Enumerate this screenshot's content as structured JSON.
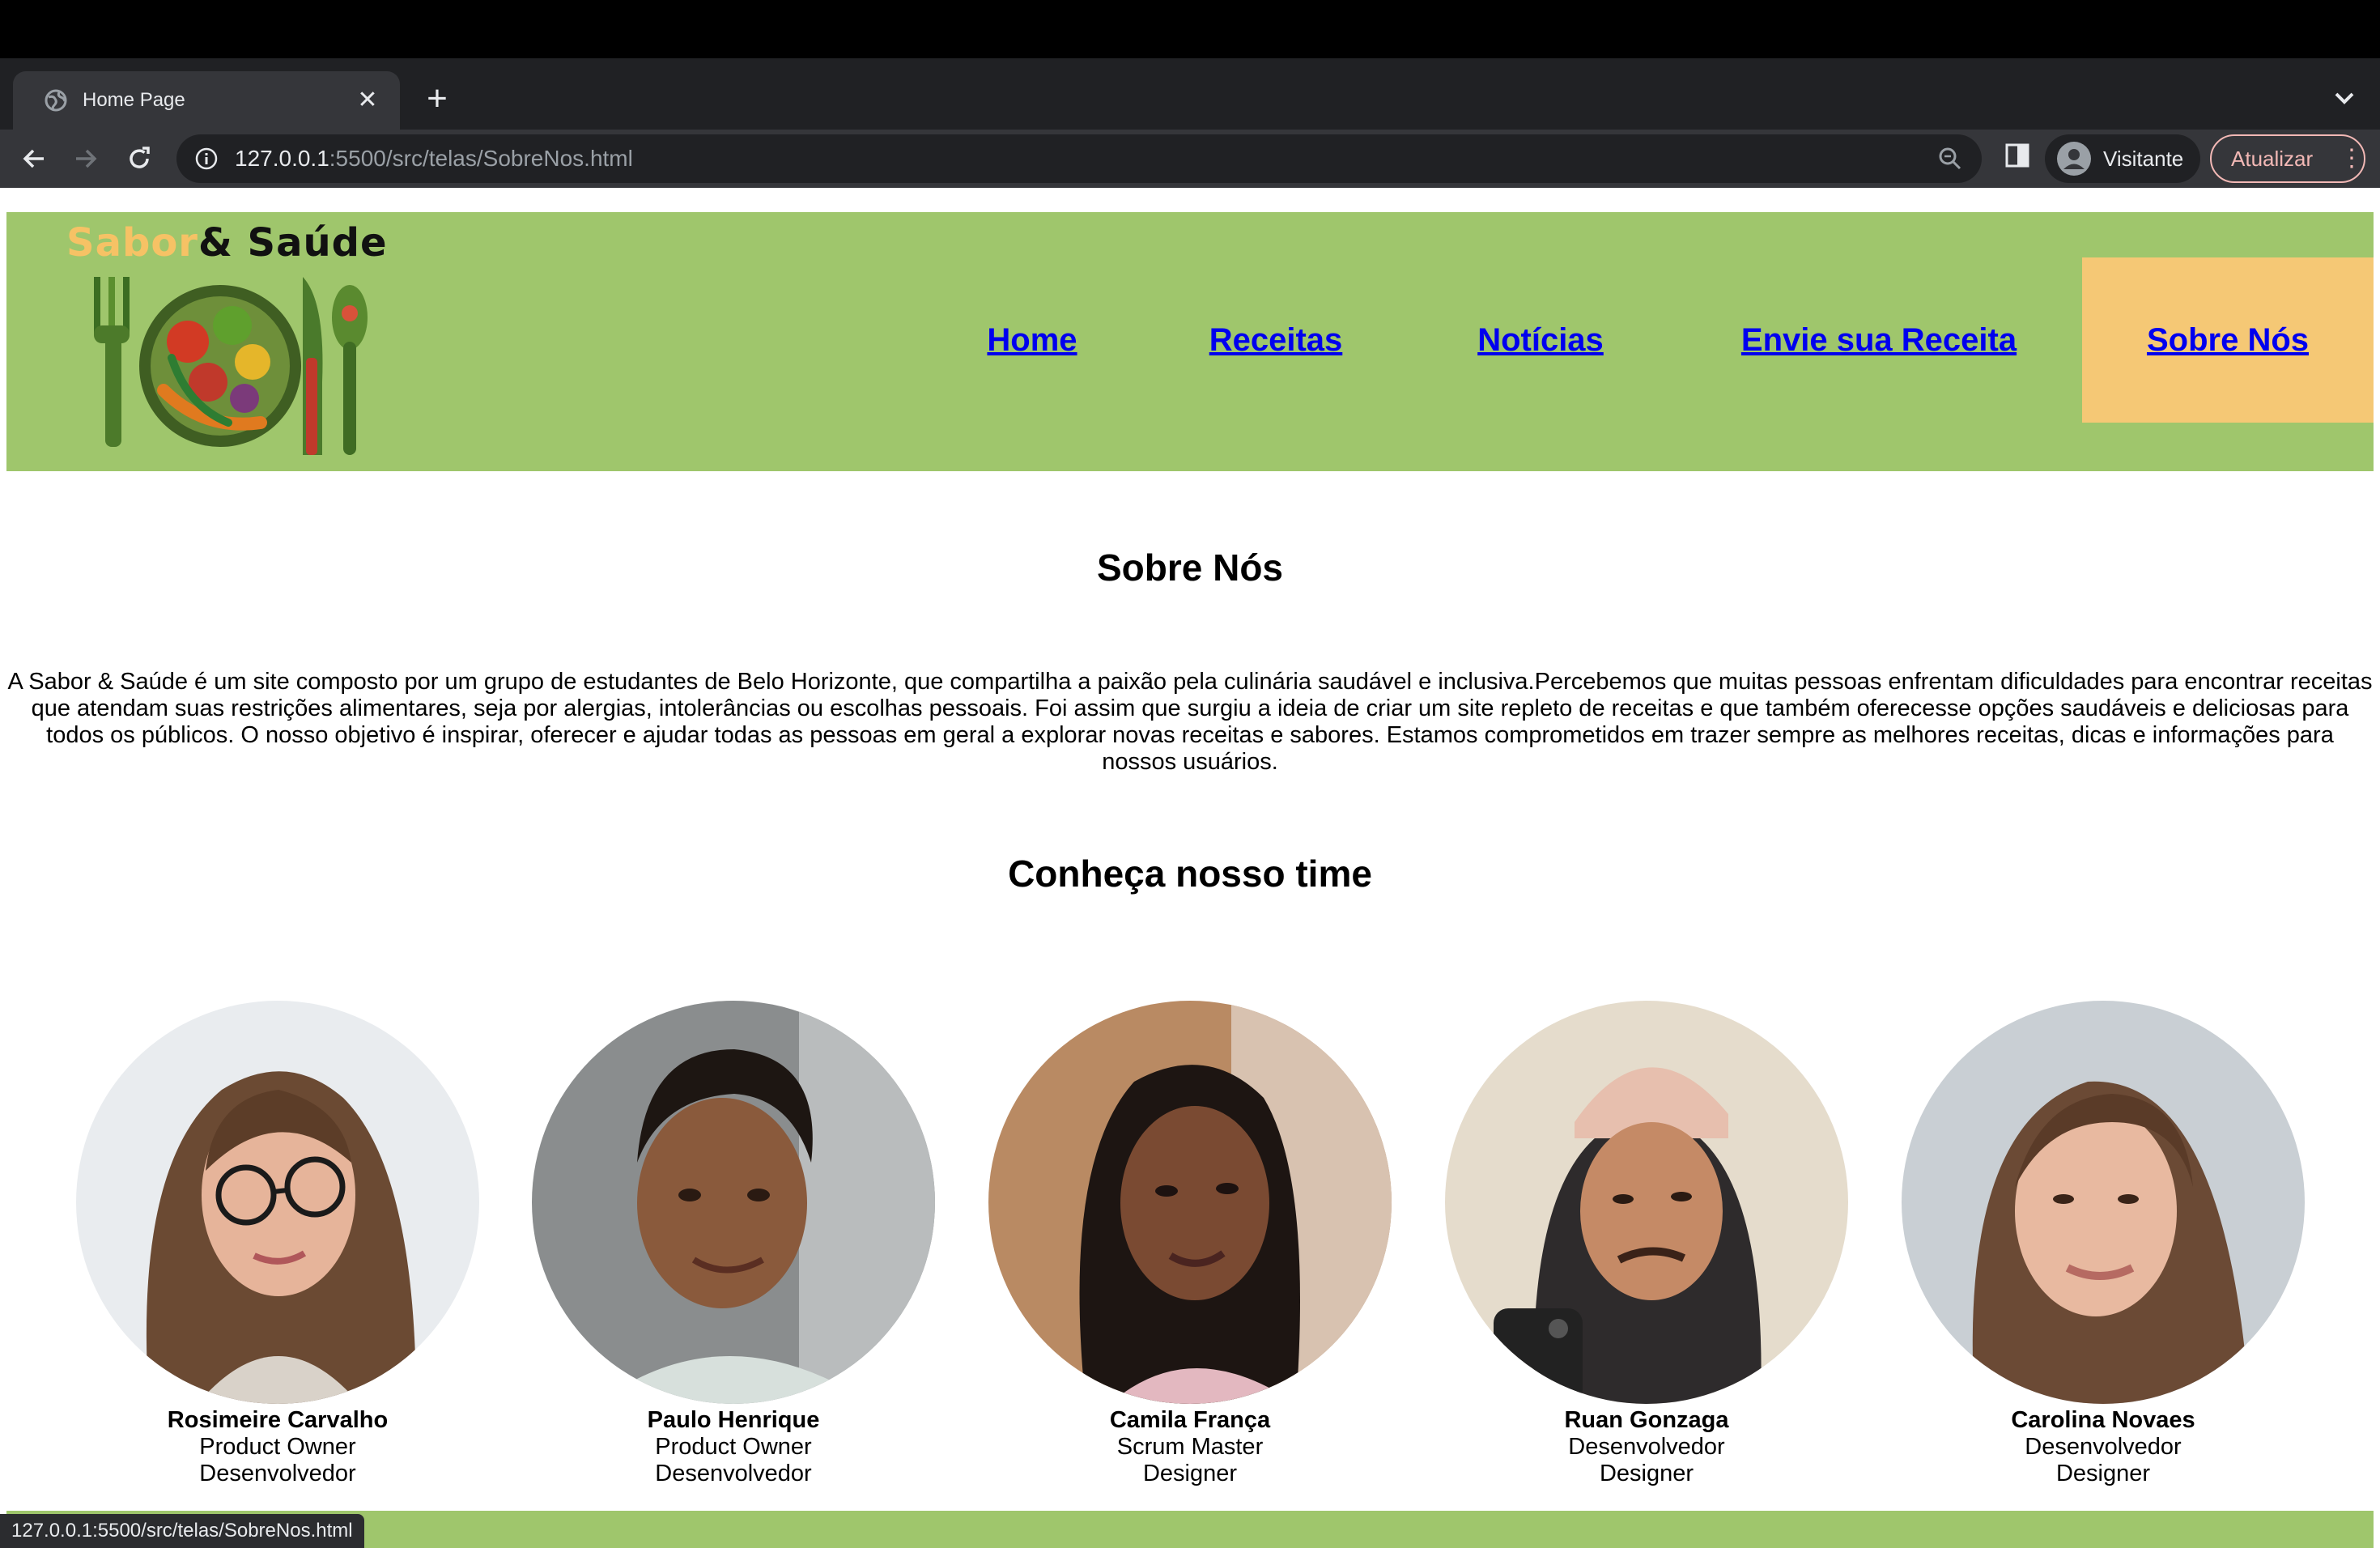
{
  "browser": {
    "tab_title": "Home Page",
    "url_host": "127.0.0.1",
    "url_rest": ":5500/src/telas/SobreNos.html",
    "profile_name": "Visitante",
    "update_label": "Atualizar",
    "status_url": "127.0.0.1:5500/src/telas/SobreNos.html"
  },
  "site": {
    "logo_word1": "Sabor",
    "logo_word2": "& Saúde",
    "nav": [
      {
        "label": "Home"
      },
      {
        "label": "Receitas"
      },
      {
        "label": "Notícias"
      },
      {
        "label": "Envie sua Receita"
      },
      {
        "label": "Sobre Nós"
      }
    ],
    "active_nav": "Sobre Nós"
  },
  "about": {
    "heading": "Sobre Nós",
    "text": "A Sabor & Saúde é um site composto por um grupo de estudantes de Belo Horizonte, que compartilha a paixão pela culinária saudável e inclusiva.Percebemos que muitas pessoas enfrentam dificuldades para encontrar receitas que atendam suas restrições alimentares, seja por alergias, intolerâncias ou escolhas pessoais. Foi assim que surgiu a ideia de criar um site repleto de receitas e que também oferecesse opções saudáveis e deliciosas para todos os públicos. O nosso objetivo é inspirar, oferecer e ajudar todas as pessoas em geral a explorar novas receitas e sabores. Estamos comprometidos em trazer sempre as melhores receitas, dicas e informações para nossos usuários."
  },
  "team": {
    "heading": "Conheça nosso time",
    "members": [
      {
        "name": "Rosimeire Carvalho",
        "roles": [
          "Product Owner",
          "Desenvolvedor"
        ]
      },
      {
        "name": "Paulo Henrique",
        "roles": [
          "Product Owner",
          "Desenvolvedor"
        ]
      },
      {
        "name": "Camila França",
        "roles": [
          "Scrum Master",
          "Designer"
        ]
      },
      {
        "name": "Ruan Gonzaga",
        "roles": [
          "Desenvolvedor",
          "Designer"
        ]
      },
      {
        "name": "Carolina Novaes",
        "roles": [
          "Desenvolvedor",
          "Designer"
        ]
      }
    ]
  },
  "colors": {
    "header_green": "#9fc66c",
    "active_nav_bg": "#f5c875",
    "link_blue": "#0000ee",
    "logo_orange": "#f6c265"
  }
}
